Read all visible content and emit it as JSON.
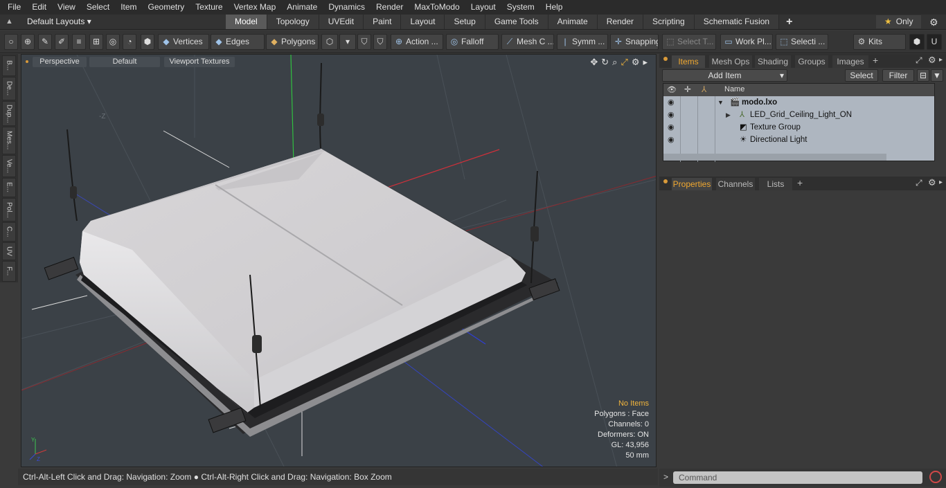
{
  "menu": [
    "File",
    "Edit",
    "View",
    "Select",
    "Item",
    "Geometry",
    "Texture",
    "Vertex Map",
    "Animate",
    "Dynamics",
    "Render",
    "MaxToModo",
    "Layout",
    "System",
    "Help"
  ],
  "layout_selector": "Default Layouts ▾",
  "tabs": [
    "Model",
    "Topology",
    "UVEdit",
    "Paint",
    "Layout",
    "Setup",
    "Game Tools",
    "Animate",
    "Render",
    "Scripting",
    "Schematic Fusion"
  ],
  "active_tab": "Model",
  "only_label": "Only",
  "toolbar": {
    "vertices": "Vertices",
    "edges": "Edges",
    "polygons": "Polygons",
    "action": "Action ...",
    "falloff": "Falloff",
    "mesh": "Mesh C ...",
    "symm": "Symm ...",
    "snapping": "Snapping",
    "select_t": "Select T...",
    "work_pl": "Work Pl...",
    "selecti": "Selecti ...",
    "kits": "Kits"
  },
  "left_tabs": [
    "B...",
    "De...",
    "Dup...",
    "Mes...",
    "Ve...",
    "E...",
    "Pol...",
    "C...",
    "UV",
    "F..."
  ],
  "viewport": {
    "perspective": "Perspective",
    "default": "Default",
    "viewport_textures": "Viewport Textures",
    "stats": {
      "no_items": "No Items",
      "polygons": "Polygons : Face",
      "channels": "Channels: 0",
      "deformers": "Deformers: ON",
      "gl": "GL: 43,956",
      "scale": "50 mm"
    }
  },
  "status_text": "Ctrl-Alt-Left Click and Drag: Navigation: Zoom ● Ctrl-Alt-Right Click and Drag: Navigation: Box Zoom",
  "items_panel": {
    "tabs": [
      "Items",
      "Mesh Ops",
      "Shading",
      "Groups",
      "Images"
    ],
    "add_item": "Add Item",
    "select": "Select",
    "filter": "Filter",
    "column_name": "Name",
    "rows": [
      "modo.lxo",
      "LED_Grid_Ceiling_Light_ON",
      "Texture Group",
      "Directional Light"
    ]
  },
  "properties_panel": {
    "tabs": [
      "Properties",
      "Channels",
      "Lists"
    ]
  },
  "command_placeholder": "Command"
}
